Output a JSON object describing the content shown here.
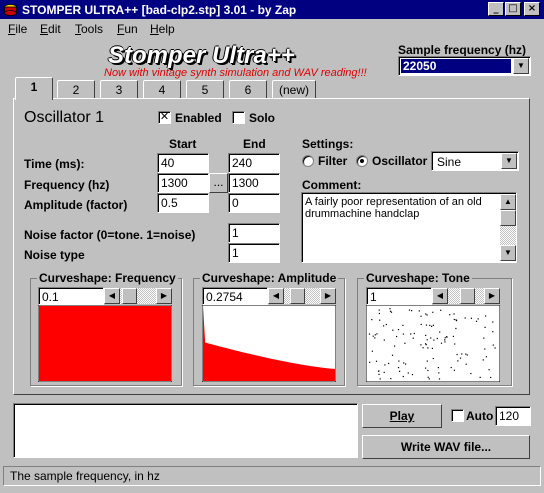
{
  "window": {
    "title": "STOMPER ULTRA++ [bad-clp2.stp] 3.01 - by Zap",
    "minimize_icon": "minimize-icon",
    "maximize_icon": "maximize-icon",
    "close_icon": "close-icon"
  },
  "menu": {
    "items": [
      {
        "first": "F",
        "rest": "ile"
      },
      {
        "first": "E",
        "rest": "dit"
      },
      {
        "first": "T",
        "rest": "ools"
      },
      {
        "first": "F",
        "rest": "un"
      },
      {
        "first": "H",
        "rest": "elp"
      }
    ]
  },
  "header": {
    "app_title": "Stomper Ultra++",
    "subtitle": "Now with vintage synth simulation and WAV reading!!!",
    "sample_freq_label": "Sample frequency (hz)",
    "sample_freq_value": "22050"
  },
  "tabs": [
    "1",
    "2",
    "3",
    "4",
    "5",
    "6",
    "(new)"
  ],
  "oscillator": {
    "heading": "Oscillator 1",
    "enabled_label": "Enabled",
    "enabled_checked": true,
    "solo_label": "Solo",
    "solo_checked": false,
    "start_header": "Start",
    "end_header": "End",
    "rows": [
      {
        "label": "Time (ms):",
        "start": "40",
        "end": "240"
      },
      {
        "label": "Frequency (hz)",
        "start": "1300",
        "end": "1300"
      },
      {
        "label": "Amplitude (factor)",
        "start": "0.5",
        "end": "0"
      }
    ],
    "ellipsis_button": "...",
    "noise_factor_label": "Noise factor (0=tone. 1=noise)",
    "noise_factor_value": "1",
    "noise_type_label": "Noise type",
    "noise_type_value": "1"
  },
  "settings": {
    "label": "Settings:",
    "filter_label": "Filter",
    "filter_selected": false,
    "oscillator_label": "Oscillator",
    "oscillator_selected": true,
    "waveform_value": "Sine",
    "comment_label": "Comment:",
    "comment_text": "A fairly poor representation of an old drummachine handclap"
  },
  "curves": [
    {
      "title": "Curveshape: Frequency",
      "value": "0.1",
      "fill": "#ff0000"
    },
    {
      "title": "Curveshape: Amplitude",
      "value": "0.2754",
      "fill": "#ff0000"
    },
    {
      "title": "Curveshape: Tone",
      "value": "1",
      "fill": "#ffffff"
    }
  ],
  "controls": {
    "play_label": "Play",
    "auto_label": "Auto",
    "auto_checked": false,
    "auto_value": "120",
    "write_wav_label": "Write WAV file..."
  },
  "status": {
    "text": "The sample frequency, in hz"
  },
  "colors": {
    "titlebar": "#000080",
    "accent_red": "#ff0000",
    "subtitle_red": "#e00000"
  }
}
